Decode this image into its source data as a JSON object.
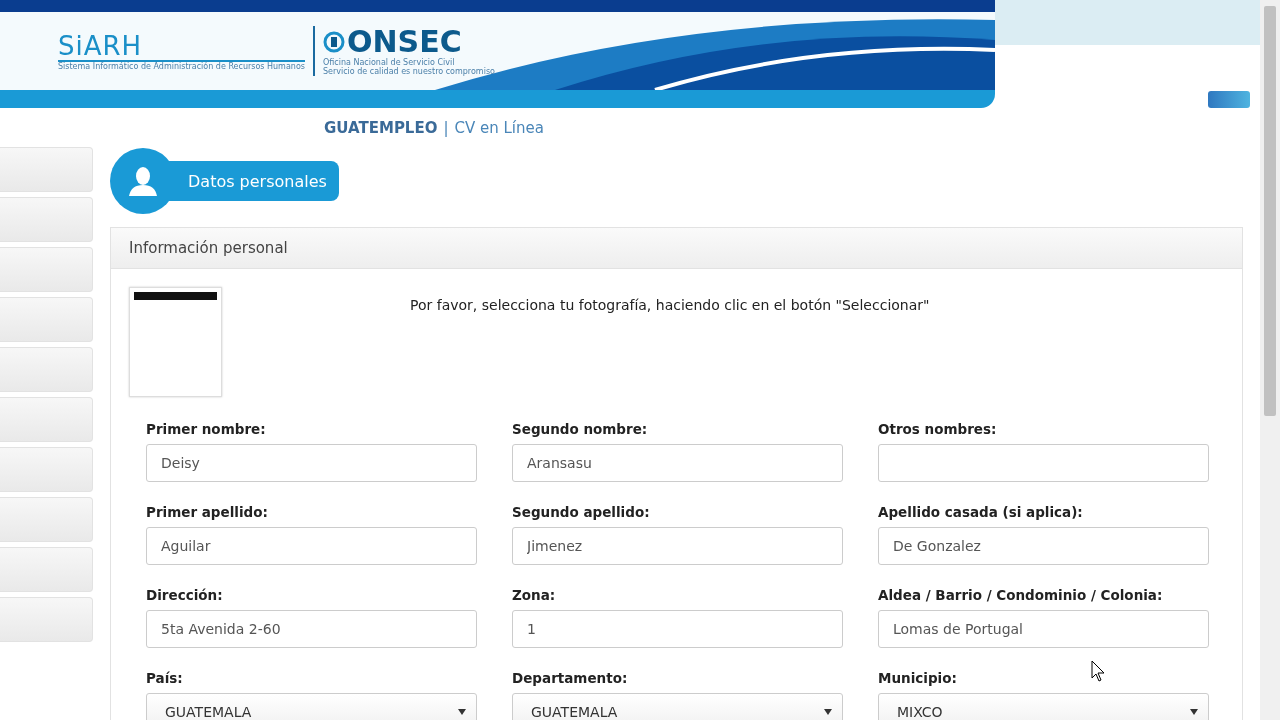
{
  "header": {
    "siarh_logo": "SiARH",
    "siarh_subtitle": "Sistema Informático de Administración de Recursos Humanos",
    "onsec_logo": "ONSEC",
    "onsec_subtitle": "Oficina Nacional de Servicio Civil",
    "onsec_tagline": "Servicio de calidad es nuestro compromiso"
  },
  "breadcrumb": {
    "brand": "GUATEMPLEO",
    "separator": "|",
    "section": "CV en Línea"
  },
  "section_badge": "Datos personales",
  "panel": {
    "title": "Información personal",
    "photo_prompt": "Por favor, selecciona tu fotografía, haciendo clic en el botón \"Seleccionar\"",
    "fields": [
      {
        "label": "Primer nombre:",
        "value": "Deisy",
        "kind": "text"
      },
      {
        "label": "Segundo nombre:",
        "value": "Aransasu",
        "kind": "text"
      },
      {
        "label": "Otros nombres:",
        "kind": "text"
      },
      {
        "label": "Primer apellido:",
        "value": "Aguilar",
        "kind": "text"
      },
      {
        "label": "Segundo apellido:",
        "value": "Jimenez",
        "kind": "text"
      },
      {
        "label": "Apellido casada (si aplica):",
        "value": "De Gonzalez",
        "kind": "text"
      },
      {
        "label": "Dirección:",
        "value": "5ta Avenida 2-60",
        "kind": "text"
      },
      {
        "label": "Zona:",
        "value": "1",
        "kind": "text"
      },
      {
        "label": "Aldea / Barrio / Condominio / Colonia:",
        "value": "Lomas de Portugal",
        "kind": "text"
      },
      {
        "label": "País:",
        "value": "GUATEMALA",
        "kind": "select"
      },
      {
        "label": "Departamento:",
        "value": "GUATEMALA",
        "kind": "select"
      },
      {
        "label": "Municipio:",
        "value": "MIXCO",
        "kind": "select"
      }
    ]
  }
}
